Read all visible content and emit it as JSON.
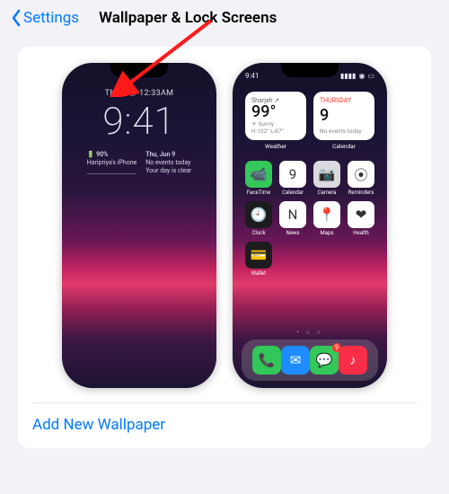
{
  "nav": {
    "back_label": "Settings",
    "title": "Wallpaper & Lock Screens"
  },
  "lock_screen": {
    "date_line": "Thu 9 ⦿ 12:33AM",
    "clock": "9:41",
    "left_box_line1": "🔋 90%",
    "left_box_line2": "Haripriya's iPhone",
    "right_box_line1": "Thu, Jun 9",
    "right_box_line2": "No events today",
    "right_box_line3": "Your day is clear"
  },
  "home_screen": {
    "status_time": "9:41",
    "widgets": [
      {
        "top": "Sharjah ↗",
        "big": "99°",
        "sub1": "☀ Sunny",
        "sub2": "H:102° L:87°",
        "label": "Weather"
      },
      {
        "top": "THURSDAY",
        "big": "9",
        "sub1": "No events today",
        "sub2": "",
        "label": "Calendar"
      }
    ],
    "apps_row1": [
      {
        "label": "FaceTime",
        "bg": "#34c759",
        "glyph": "📹"
      },
      {
        "label": "Calendar",
        "bg": "#ffffff",
        "glyph": "9"
      },
      {
        "label": "Camera",
        "bg": "#d9d9de",
        "glyph": "📷"
      },
      {
        "label": "Reminders",
        "bg": "#ffffff",
        "glyph": "⦿"
      }
    ],
    "apps_row2": [
      {
        "label": "Clock",
        "bg": "#1c1c1e",
        "glyph": "🕘"
      },
      {
        "label": "News",
        "bg": "#ffffff",
        "glyph": "N"
      },
      {
        "label": "Maps",
        "bg": "#ffffff",
        "glyph": "📍"
      },
      {
        "label": "Health",
        "bg": "#ffffff",
        "glyph": "❤"
      }
    ],
    "apps_row3": [
      {
        "label": "Wallet",
        "bg": "#1c1c1e",
        "glyph": "💳"
      }
    ],
    "dock": [
      {
        "bg": "#31c759",
        "glyph": "📞"
      },
      {
        "bg": "#1e8cff",
        "glyph": "✉",
        "badge": ""
      },
      {
        "bg": "#34c759",
        "glyph": "💬",
        "badge": "9"
      },
      {
        "bg": "#fa2d48",
        "glyph": "♪"
      }
    ],
    "pager": "• ○ ○"
  },
  "actions": {
    "add_label": "Add New Wallpaper"
  }
}
